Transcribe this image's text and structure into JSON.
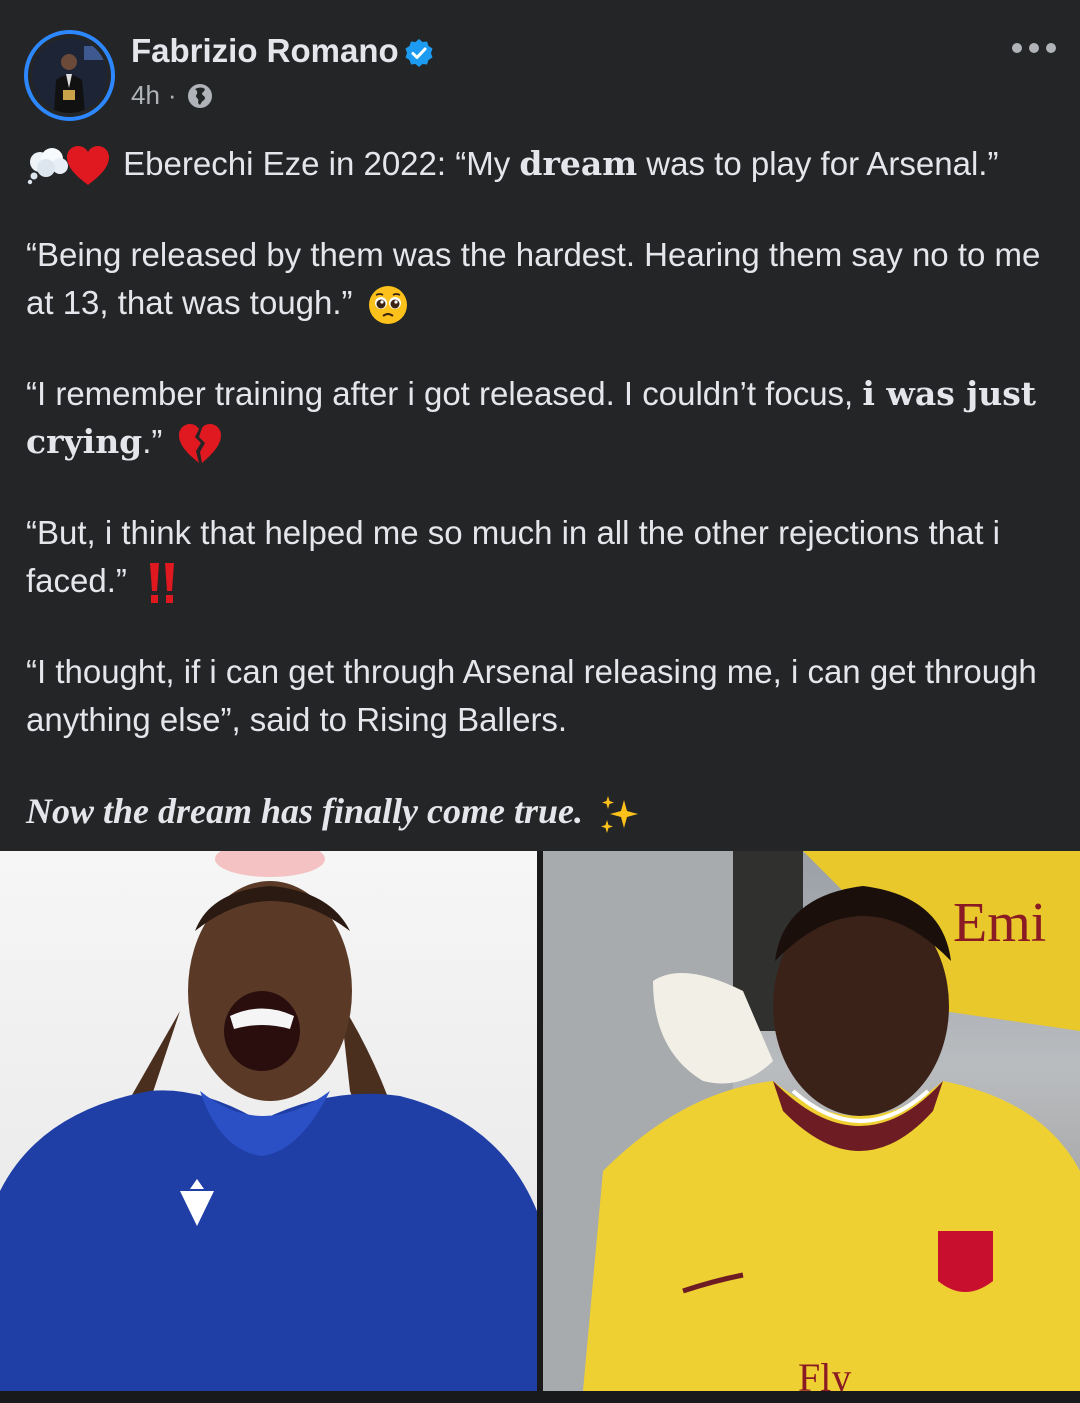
{
  "post": {
    "author": "Fabrizio Romano",
    "time": "4h",
    "separator": "·",
    "icons": {
      "verified": "verified-badge-icon",
      "audience": "globe-icon",
      "menu": "more-options-icon"
    },
    "colors": {
      "background": "#242526",
      "text": "#e4e6eb",
      "secondary_text": "#b0b3b8",
      "verified": "#1d9bf0",
      "avatar_ring": "#2d88ff"
    },
    "paragraphs": {
      "p1_a": "Eberechi Eze in 2022: “My ",
      "p1_b": "dream",
      "p1_c": " was to play for Arsenal.”",
      "p2": "“Being released by them was the hardest. Hearing them say no to me at 13, that was tough.”",
      "p3_a": "“I remember training after i got released. I couldn’t focus, ",
      "p3_b": "i was just crying",
      "p3_c": ".”",
      "p4": "“But, i think that helped me so much in all the other rejections that i faced.”",
      "p5": "“I thought, if i can get through Arsenal releasing me, i can get through anything else”, said to Rising Ballers.",
      "p6": "Now the dream has finally come true."
    },
    "emojis": {
      "p1": [
        "thought-balloon-emoji",
        "red-heart-emoji"
      ],
      "p2": "pleading-face-emoji",
      "p3": "broken-heart-emoji",
      "p4": "double-exclamation-emoji",
      "p6": "sparkles-emoji"
    },
    "photos": {
      "left": {
        "logo_text": ""
      },
      "right": {
        "shirt_text_top": "Emi",
        "shirt_text_bottom": "Fly"
      }
    }
  }
}
